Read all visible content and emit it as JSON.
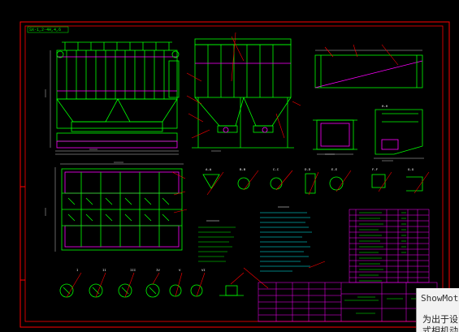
{
  "drawing": {
    "title_block_label": "SX-1,2-4H,4,6",
    "section_labels": [
      "A-A",
      "B-B",
      "C-C",
      "D-D",
      "E-E",
      "F-F",
      "G-G",
      "H-H"
    ],
    "detail_labels": [
      "I",
      "II",
      "III",
      "IV",
      "V",
      "VI"
    ],
    "colors": {
      "background": "#000000",
      "border": "#ff0000",
      "geometry": "#00ff00",
      "leader": "#ff0000",
      "dimension": "#ffffff",
      "highlight": "#ff00ff",
      "notes": "#00ffff"
    }
  },
  "watermark": {
    "title": "ShowMot",
    "line1": "为出于设",
    "line2": "式相机动"
  }
}
